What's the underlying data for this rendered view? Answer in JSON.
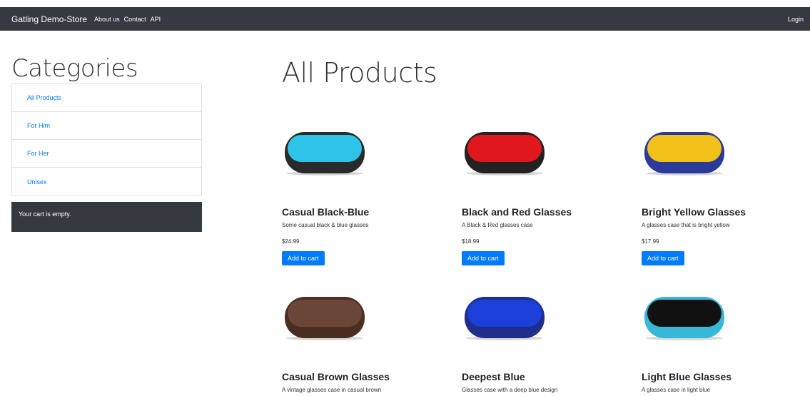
{
  "navbar": {
    "brand": "Gatling Demo-Store",
    "links": [
      "About us",
      "Contact",
      "API"
    ],
    "login": "Login"
  },
  "sidebar": {
    "title": "Categories",
    "categories": [
      "All Products",
      "For Him",
      "For Her",
      "Unisex"
    ],
    "cart_text": "Your cart is empty."
  },
  "main": {
    "title": "All Products",
    "add_label": "Add to cart",
    "products": [
      {
        "name": "Casual Black-Blue",
        "description": "Some casual black & blue glasses",
        "price": "$24.99",
        "shell_color": "#2a2a2a",
        "lining_color": "#2ec4ea"
      },
      {
        "name": "Black and Red Glasses",
        "description": "A Black & Red glasses case",
        "price": "$18.99",
        "shell_color": "#222222",
        "lining_color": "#e0181e"
      },
      {
        "name": "Bright Yellow Glasses",
        "description": "A glasses case that is bright yellow",
        "price": "$17.99",
        "shell_color": "#2a3a9a",
        "lining_color": "#f2c21a"
      },
      {
        "name": "Casual Brown Glasses",
        "description": "A vintage glasses case in casual brown",
        "price": "",
        "shell_color": "#4a2e22",
        "lining_color": "#6a4638"
      },
      {
        "name": "Deepest Blue",
        "description": "Glasses case with a deep blue design",
        "price": "",
        "shell_color": "#1f2e8a",
        "lining_color": "#1b3fd8"
      },
      {
        "name": "Light Blue Glasses",
        "description": "A glasses case in light blue",
        "price": "",
        "shell_color": "#38b8d8",
        "lining_color": "#111111"
      }
    ]
  }
}
